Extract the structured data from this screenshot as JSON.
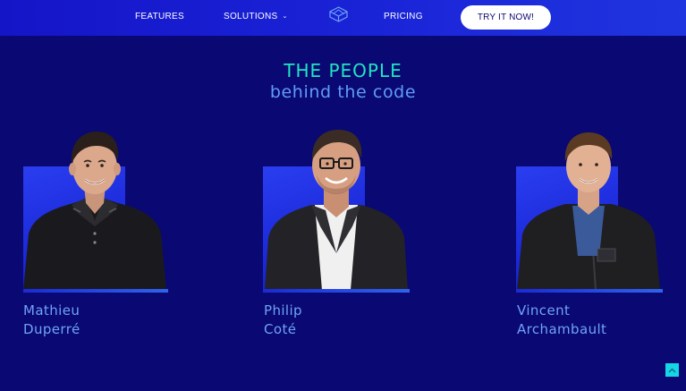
{
  "nav": {
    "features_label": "FEATURES",
    "solutions_label": "SOLUTIONS",
    "pricing_label": "PRICING",
    "cta_label": "TRY IT NOW!",
    "icon_logo": "geometric-logo-icon",
    "icon_solutions_chevron": "chevron-down-icon"
  },
  "section": {
    "title_line_1": "THE PEOPLE",
    "title_line_2": "behind the code"
  },
  "team": [
    {
      "name": "Mathieu Duperré"
    },
    {
      "name": "Philip Coté"
    },
    {
      "name_line_1": "Vincent",
      "name_line_2": "Archambault"
    }
  ],
  "colors": {
    "page_background": "#0a0872",
    "nav_gradient_start": "#1515c8",
    "heading_accent": "#1ee6c2",
    "subheading": "#5f9cf5",
    "name_text": "#6fa3f5",
    "scroll_button": "#16d6e6"
  },
  "scroll_top_icon": "chevron-up-icon"
}
